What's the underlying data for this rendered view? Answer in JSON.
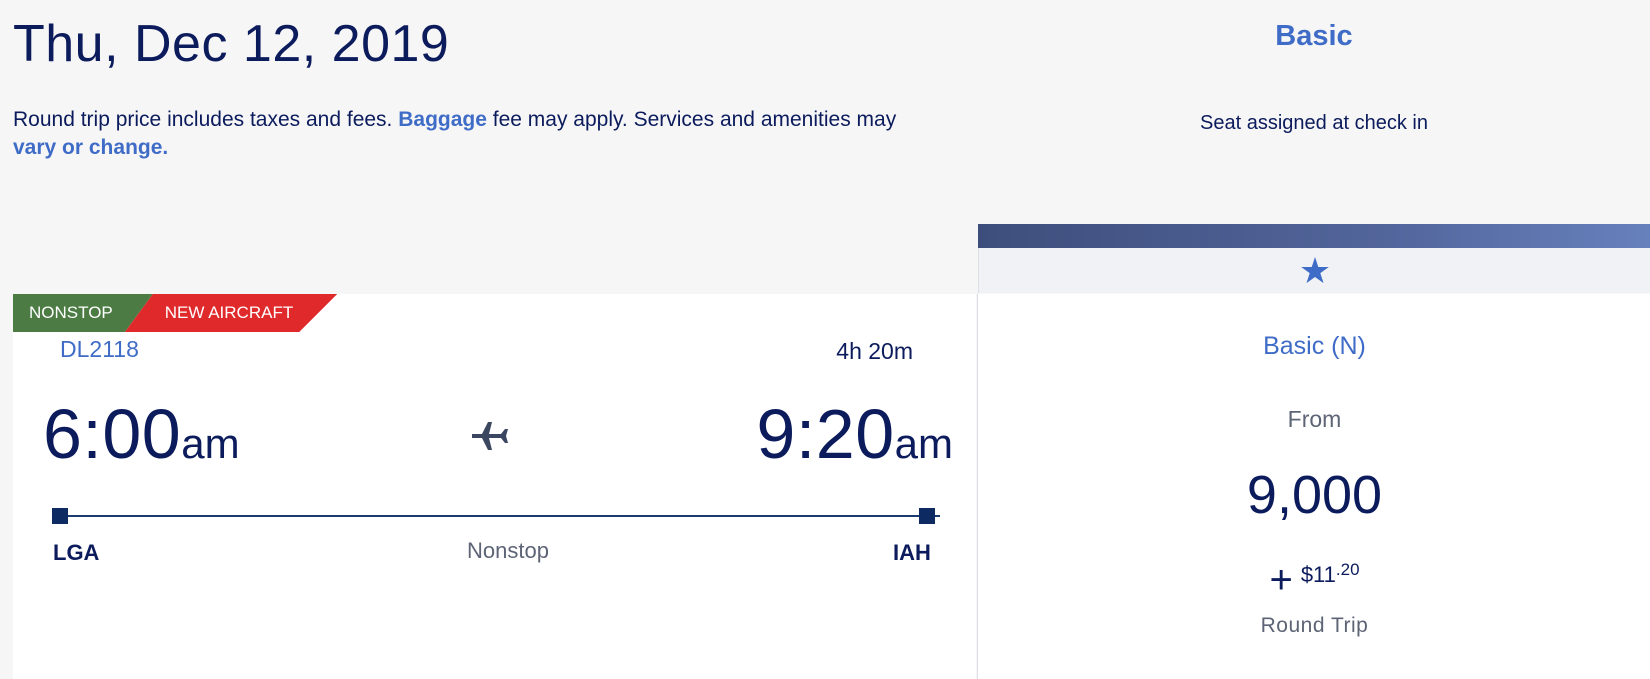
{
  "header": {
    "date": "Thu, Dec 12, 2019",
    "disclaimer_prefix": "Round trip price includes taxes and fees. ",
    "baggage_link": "Baggage",
    "disclaimer_middle": " fee may apply. Services and amenities may ",
    "change_link": "vary or change."
  },
  "fare_column": {
    "title": "Basic",
    "feature": "Seat assigned at check in",
    "bar_color": "#52659b",
    "icon": "star-icon"
  },
  "flight": {
    "badges": {
      "nonstop": "NONSTOP",
      "new_aircraft": "NEW AIRCRAFT"
    },
    "flight_number": "DL2118",
    "duration": "4h 20m",
    "depart_time": "6:00",
    "depart_ampm": "am",
    "arrive_time": "9:20",
    "arrive_ampm": "am",
    "origin": "LGA",
    "destination": "IAH",
    "stops": "Nonstop",
    "icon": "airplane-icon"
  },
  "fare": {
    "class": "Basic (N)",
    "from_label": "From",
    "miles": "9,000",
    "plus": "+",
    "cash_dollars": "$11",
    "cash_cents": ".20",
    "trip_type": "Round Trip"
  },
  "colors": {
    "navy": "#0b1b5c",
    "link_blue": "#3f6cc7",
    "nonstop_green": "#4c7c43",
    "new_aircraft_red": "#e0292b"
  }
}
